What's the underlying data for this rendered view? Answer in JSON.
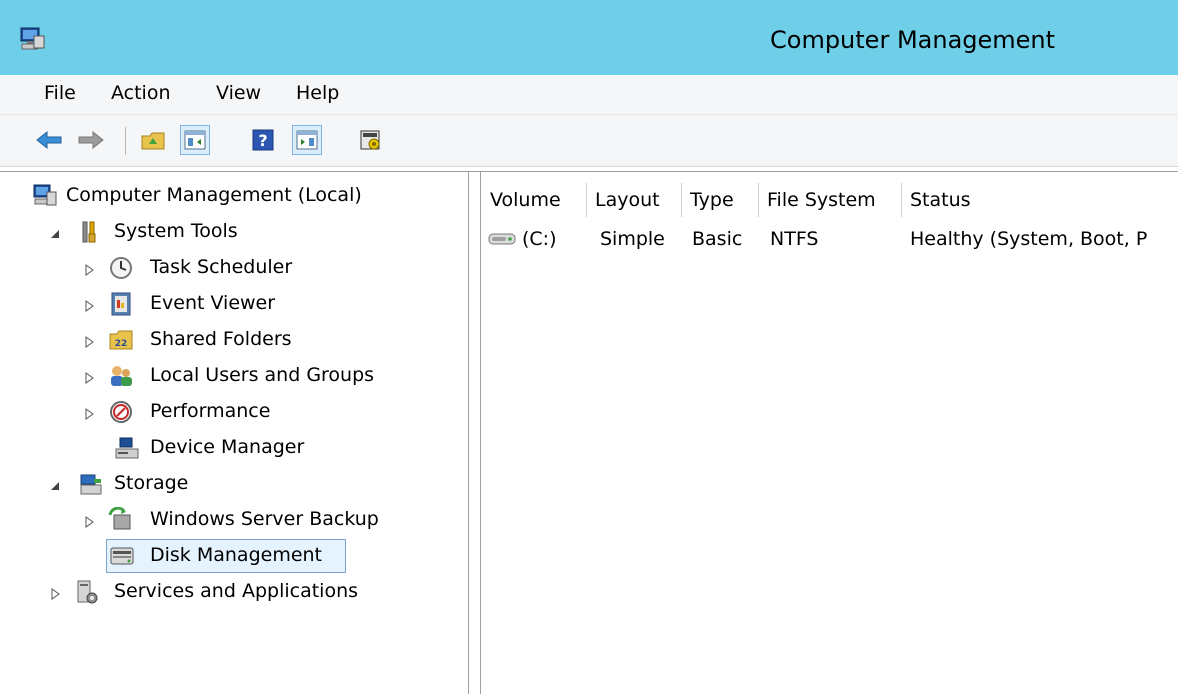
{
  "window": {
    "title": "Computer Management",
    "app_icon": "computer-management-icon",
    "title_bar_color": "#6fcfe8"
  },
  "menu": {
    "items": [
      "File",
      "Action",
      "View",
      "Help"
    ]
  },
  "toolbar": {
    "buttons": [
      "back-arrow-icon",
      "forward-arrow-icon",
      "up-folder-icon",
      "show-hide-tree-icon",
      "help-icon",
      "show-hide-action-pane-icon",
      "properties-icon"
    ]
  },
  "tree": {
    "root": "Computer Management (Local)",
    "items": [
      {
        "label": "System Tools",
        "icon": "tools-icon",
        "expanded": true
      },
      {
        "label": "Task Scheduler",
        "icon": "clock-icon"
      },
      {
        "label": "Event Viewer",
        "icon": "event-viewer-icon"
      },
      {
        "label": "Shared Folders",
        "icon": "shared-folder-icon"
      },
      {
        "label": "Local Users and Groups",
        "icon": "users-icon"
      },
      {
        "label": "Performance",
        "icon": "performance-icon"
      },
      {
        "label": "Device Manager",
        "icon": "device-manager-icon"
      },
      {
        "label": "Storage",
        "icon": "storage-icon",
        "expanded": true
      },
      {
        "label": "Windows Server Backup",
        "icon": "backup-icon"
      },
      {
        "label": "Disk Management",
        "icon": "disk-icon",
        "selected": true
      },
      {
        "label": "Services and Applications",
        "icon": "services-icon"
      }
    ]
  },
  "list": {
    "columns": [
      "Volume",
      "Layout",
      "Type",
      "File System",
      "Status"
    ],
    "rows": [
      {
        "volume": "(C:)",
        "layout": "Simple",
        "type": "Basic",
        "file_system": "NTFS",
        "status": "Healthy (System, Boot, P"
      }
    ]
  }
}
